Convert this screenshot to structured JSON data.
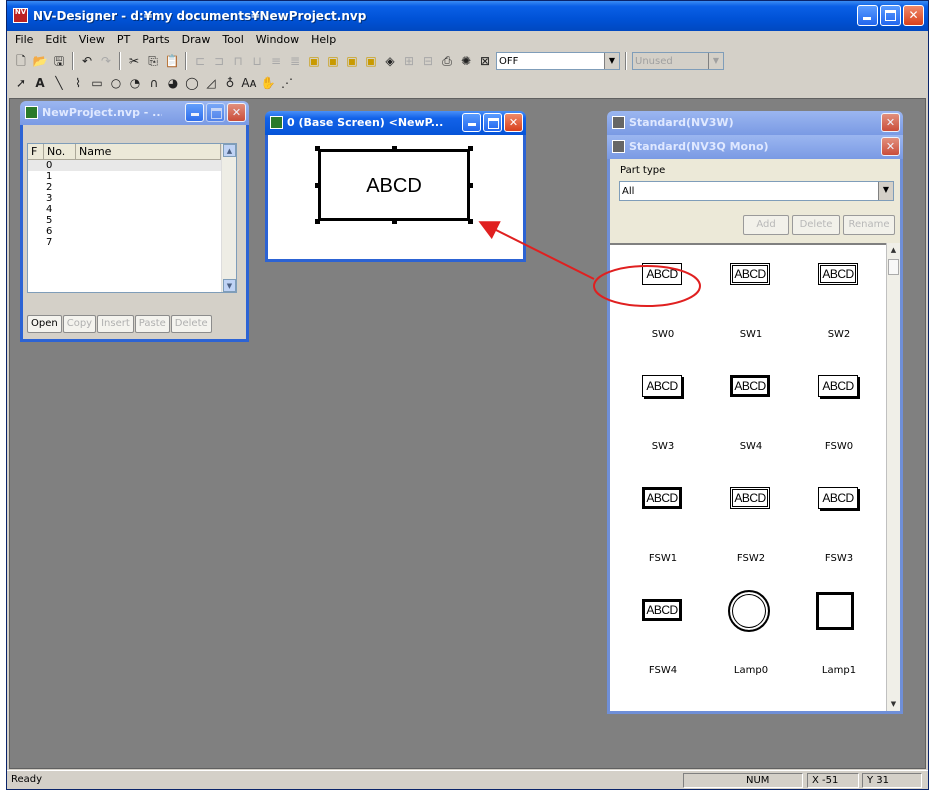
{
  "app": {
    "title": "NV-Designer - d:¥my documents¥NewProject.nvp",
    "icon_glyph": "NV"
  },
  "menu": [
    "File",
    "Edit",
    "View",
    "PT",
    "Parts",
    "Draw",
    "Tool",
    "Window",
    "Help"
  ],
  "toolbar": {
    "combo_value": "OFF",
    "disabled_combo_value": "Unused"
  },
  "project_window": {
    "title": "NewProject.nvp - ...",
    "columns": [
      "F",
      "No.",
      "Name"
    ],
    "rows": [
      "0",
      "1",
      "2",
      "3",
      "4",
      "5",
      "6",
      "7"
    ],
    "buttons": [
      "Open",
      "Copy",
      "Insert",
      "Paste",
      "Delete"
    ]
  },
  "base_window": {
    "title": "0 (Base Screen) <NewP...",
    "part_text": "ABCD"
  },
  "palette": {
    "title_inactive": "Standard(NV3W)",
    "title_active": "Standard(NV3Q Mono)",
    "part_type_label": "Part type",
    "part_type_value": "All",
    "buttons": [
      "Add",
      "Delete",
      "Rename"
    ],
    "parts": [
      {
        "name": "SW0",
        "text": "ABCD",
        "style": "plain"
      },
      {
        "name": "SW1",
        "text": "ABCD",
        "style": "dbl"
      },
      {
        "name": "SW2",
        "text": "ABCD",
        "style": "dbl"
      },
      {
        "name": "SW3",
        "text": "ABCD",
        "style": "shadow"
      },
      {
        "name": "SW4",
        "text": "ABCD",
        "style": "thick"
      },
      {
        "name": "FSW0",
        "text": "ABCD",
        "style": "shadow"
      },
      {
        "name": "FSW1",
        "text": "ABCD",
        "style": "thick"
      },
      {
        "name": "FSW2",
        "text": "ABCD",
        "style": "dbl"
      },
      {
        "name": "FSW3",
        "text": "ABCD",
        "style": "shadow"
      },
      {
        "name": "FSW4",
        "text": "ABCD",
        "style": "thick"
      },
      {
        "name": "Lamp0",
        "text": "",
        "style": "lamp0"
      },
      {
        "name": "Lamp1",
        "text": "",
        "style": "lamp1"
      }
    ]
  },
  "status": {
    "ready": "Ready",
    "num": "NUM",
    "x": "X  -51",
    "y": "Y  31"
  },
  "colors": {
    "annotation": "#e02020"
  }
}
